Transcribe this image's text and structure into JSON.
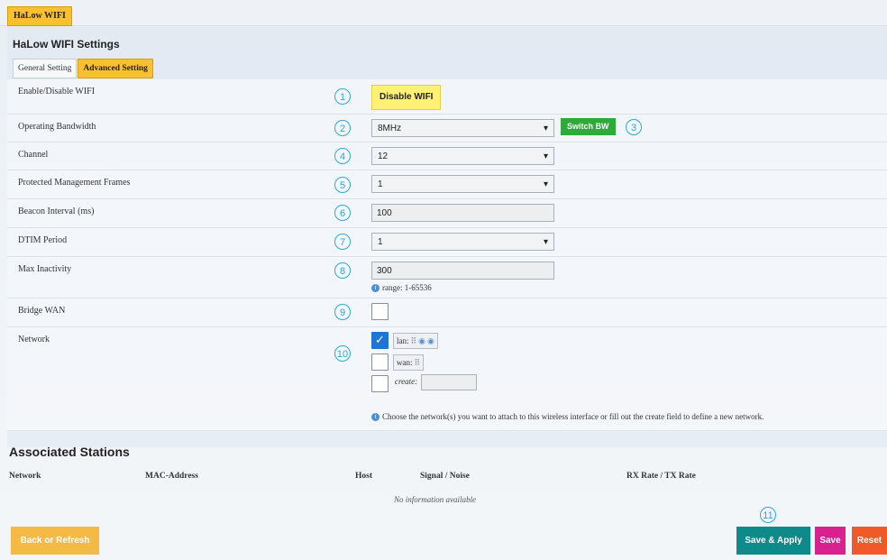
{
  "top_tab": "HaLow WIFI",
  "panel_title": "HaLow WIFI Settings",
  "subtabs": [
    "General Setting",
    "Advanced Setting"
  ],
  "rows": {
    "enable": {
      "label": "Enable/Disable WIFI",
      "num": "1",
      "button": "Disable WIFI"
    },
    "bandwidth": {
      "label": "Operating Bandwidth",
      "num": "2",
      "value": "8MHz",
      "switch_num": "3",
      "switch_button": "Switch BW"
    },
    "channel": {
      "label": "Channel",
      "num": "4",
      "value": "12"
    },
    "pmf": {
      "label": "Protected Management Frames",
      "num": "5",
      "value": "1"
    },
    "beacon": {
      "label": "Beacon Interval (ms)",
      "num": "6",
      "value": "100"
    },
    "dtim": {
      "label": "DTIM Period",
      "num": "7",
      "value": "1"
    },
    "inactivity": {
      "label": "Max Inactivity",
      "num": "8",
      "value": "300",
      "hint": "range: 1-65536"
    },
    "bridge": {
      "label": "Bridge WAN",
      "num": "9"
    },
    "network": {
      "label": "Network",
      "num": "10",
      "options": [
        {
          "label": "lan:",
          "checked": true
        },
        {
          "label": "wan:",
          "checked": false
        },
        {
          "label": "create:",
          "checked": false
        }
      ],
      "hint": "Choose the network(s) you want to attach to this wireless interface or fill out the create field to define a new network."
    }
  },
  "associated": {
    "title": "Associated Stations",
    "headers": [
      "Network",
      "MAC-Address",
      "Host",
      "Signal / Noise",
      "RX Rate / TX Rate"
    ],
    "empty": "No information available"
  },
  "footer": {
    "back": "Back or Refresh",
    "num": "11",
    "save_apply": "Save & Apply",
    "save": "Save",
    "reset": "Reset"
  },
  "colors": {
    "accent_tab": "#fbc02d",
    "switch_green": "#2eaa3a",
    "save_apply": "#0e8a8a",
    "save": "#d8218f",
    "reset": "#f05a28",
    "back": "#f5b945",
    "callout": "#29a8e0"
  }
}
